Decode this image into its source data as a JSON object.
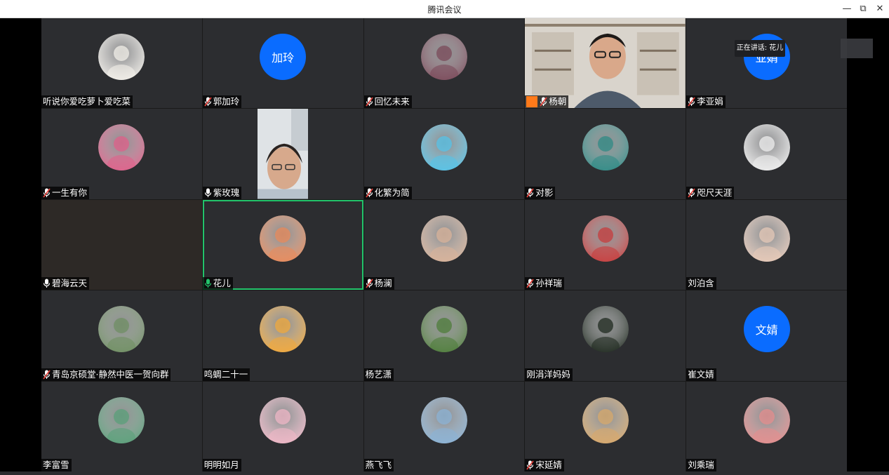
{
  "window": {
    "title": "腾讯会议",
    "controls": {
      "minimize": "—",
      "restore": "⧉",
      "close": "✕"
    }
  },
  "speaking_toast": "正在讲话: 花儿",
  "participants": [
    {
      "name": "听说你爱吃萝卜爱吃菜",
      "mic": "none",
      "avatar": "cartoon-avatar",
      "avatar_color": "#f3f0ea"
    },
    {
      "name": "郭加玲",
      "mic": "muted",
      "avatar_text": "加玲"
    },
    {
      "name": "回忆未来",
      "mic": "muted",
      "avatar": "flower-photo-avatar",
      "avatar_color": "#7b4a5a"
    },
    {
      "name": "杨朝",
      "mic": "muted",
      "video": true,
      "host_badge": true
    },
    {
      "name": "李亚娟",
      "mic": "muted",
      "avatar_text": "亚娟"
    },
    {
      "name": "一生有你",
      "mic": "muted",
      "avatar": "lotus-avatar",
      "avatar_color": "#e0608a"
    },
    {
      "name": "紫玫瑰",
      "mic": "on",
      "video": true
    },
    {
      "name": "化繁为简",
      "mic": "muted",
      "avatar": "beach-cartoon-avatar",
      "avatar_color": "#55c3e8"
    },
    {
      "name": "对影",
      "mic": "muted",
      "avatar": "cat-umbrella-avatar",
      "avatar_color": "#2f8b86"
    },
    {
      "name": "咫尺天涯",
      "mic": "muted",
      "avatar": "calligraphy-avatar",
      "avatar_color": "#efefef"
    },
    {
      "name": "碧海云天",
      "mic": "on",
      "dark": true
    },
    {
      "name": "花儿",
      "mic": "speaking",
      "avatar": "sunset-flower-avatar",
      "avatar_color": "#e98a5a",
      "active": true
    },
    {
      "name": "杨澜",
      "mic": "muted",
      "avatar": "portrait-avatar",
      "avatar_color": "#d9b39a"
    },
    {
      "name": "孙祥瑞",
      "mic": "muted",
      "avatar": "girl-red-avatar",
      "avatar_color": "#c83c3c"
    },
    {
      "name": "刘泊含",
      "mic": "none",
      "avatar": "anime-girl-avatar",
      "avatar_color": "#e7c9b8"
    },
    {
      "name": "青岛京硕堂·静然中医一贺向群",
      "mic": "muted",
      "avatar": "landscape-avatar",
      "avatar_color": "#6f8f63"
    },
    {
      "name": "鸣蜩二十一",
      "mic": "none",
      "avatar": "cartoon-boy-avatar",
      "avatar_color": "#f2a93b"
    },
    {
      "name": "杨艺潇",
      "mic": "none",
      "avatar": "garden-path-avatar",
      "avatar_color": "#4e7d3a"
    },
    {
      "name": "刚涓洋妈妈",
      "mic": "none",
      "avatar": "night-lake-avatar",
      "avatar_color": "#1f2a1f"
    },
    {
      "name": "崔文婧",
      "mic": "none",
      "avatar_text": "文婧"
    },
    {
      "name": "李富雪",
      "mic": "none",
      "avatar": "woman-portrait-avatar",
      "avatar_color": "#5aa07a"
    },
    {
      "name": "明明如月",
      "mic": "none",
      "avatar": "anime-pink-avatar",
      "avatar_color": "#f0b7c7"
    },
    {
      "name": "燕飞飞",
      "mic": "none",
      "avatar": "seaside-avatar",
      "avatar_color": "#8bb3d6"
    },
    {
      "name": "宋延婧",
      "mic": "muted",
      "avatar": "cat-shelf-avatar",
      "avatar_color": "#d8a96b"
    },
    {
      "name": "刘乘瑞",
      "mic": "none",
      "avatar": "red-girl-avatar",
      "avatar_color": "#e58d8d"
    }
  ],
  "colors": {
    "accent_blue": "#0a6cff",
    "speaking_green": "#22c36a",
    "muted_red": "#e0403a",
    "tile_bg": "#2c2d30"
  }
}
